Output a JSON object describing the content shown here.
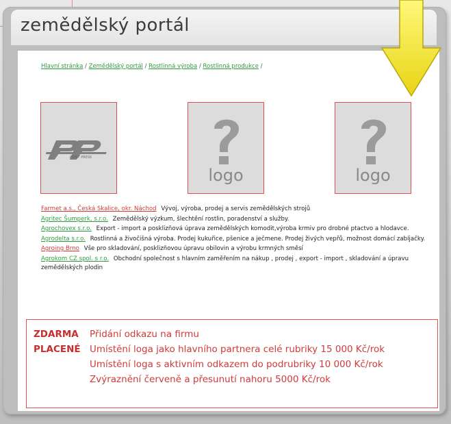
{
  "header": {
    "title": "zemědělský portál"
  },
  "breadcrumb": {
    "items": [
      {
        "label": "Hlavní stránka"
      },
      {
        "label": "Zemědělský portál"
      },
      {
        "label": "Rostlinná výroba"
      },
      {
        "label": "Rostlinná produkce"
      }
    ],
    "separator": "/"
  },
  "logos": [
    {
      "kind": "pp-logo",
      "label": "PRINT PRESS"
    },
    {
      "kind": "placeholder",
      "label": "logo",
      "symbol": "?"
    },
    {
      "kind": "placeholder",
      "label": "logo",
      "symbol": "?"
    }
  ],
  "firms": [
    {
      "name": "Farmet a.s., Česká Skalice, okr. Náchod",
      "color": "#d23a3a",
      "description": "Vývoj, výroba, prodej a servis zemědělských strojů"
    },
    {
      "name": "Agritec Šumperk, s.r.o.",
      "color": "#2e9b3e",
      "description": "Zemědělský výzkum, šlechtění rostlin, poradenství a služby."
    },
    {
      "name": "Agrochovex s.r.o.",
      "color": "#2e9b3e",
      "description": "Export - import a posklizňová úprava zemědělských komodit,výroba krmiv pro drobné ptactvo a hlodavce."
    },
    {
      "name": "Agrodelta s.r.o.",
      "color": "#2e9b3e",
      "description": "Rostlinná a živočišná výroba. Prodej kukuřice, pšenice a ječmene. Prodej živých vepřů, možnost domácí zabíjačky."
    },
    {
      "name": "Agroing Brno",
      "color": "#d23a3a",
      "description": "Vše pro skladování, posklizňovou úpravu obilovin a výrobu krmných směsí"
    },
    {
      "name": "Agrokom CZ spol. s r.o.",
      "color": "#2e9b3e",
      "description": "Obchodní společnost s hlavním zaměřením na nákup , prodej , export - import , skladování a úpravu zemědělských plodin"
    }
  ],
  "pricing": {
    "free_label": "ZDARMA",
    "free_text": "Přidání odkazu na firmu",
    "paid_label": "PLACENÉ",
    "paid_lines": [
      "Umístění loga jako hlavního partnera celé rubriky 15 000 Kč/rok",
      "Umístění loga s aktivním odkazem do podrubriky 10 000 Kč/rok",
      "Zvýraznění červeně a přesunutí nahoru 5000 Kč/rok"
    ]
  },
  "colors": {
    "accent_red": "#d03a3a",
    "link_green": "#2e9b3e",
    "arrow_yellow": "#f2e21c"
  },
  "icons": {
    "arrow": "down-arrow-icon"
  }
}
